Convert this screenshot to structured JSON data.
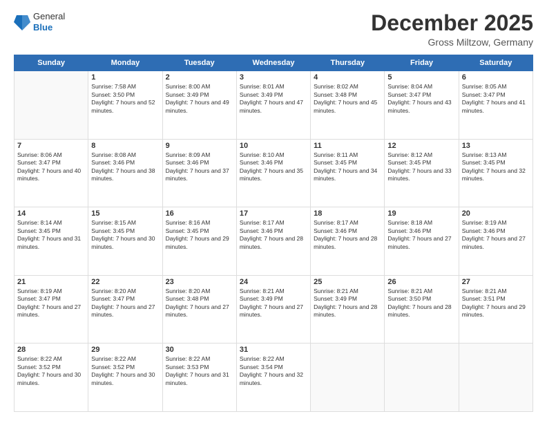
{
  "header": {
    "logo": {
      "general": "General",
      "blue": "Blue"
    },
    "title": "December 2025",
    "location": "Gross Miltzow, Germany"
  },
  "calendar": {
    "weekdays": [
      "Sunday",
      "Monday",
      "Tuesday",
      "Wednesday",
      "Thursday",
      "Friday",
      "Saturday"
    ],
    "weeks": [
      [
        {
          "day": null
        },
        {
          "day": 1,
          "sunrise": "7:58 AM",
          "sunset": "3:50 PM",
          "daylight": "7 hours and 52 minutes."
        },
        {
          "day": 2,
          "sunrise": "8:00 AM",
          "sunset": "3:49 PM",
          "daylight": "7 hours and 49 minutes."
        },
        {
          "day": 3,
          "sunrise": "8:01 AM",
          "sunset": "3:49 PM",
          "daylight": "7 hours and 47 minutes."
        },
        {
          "day": 4,
          "sunrise": "8:02 AM",
          "sunset": "3:48 PM",
          "daylight": "7 hours and 45 minutes."
        },
        {
          "day": 5,
          "sunrise": "8:04 AM",
          "sunset": "3:47 PM",
          "daylight": "7 hours and 43 minutes."
        },
        {
          "day": 6,
          "sunrise": "8:05 AM",
          "sunset": "3:47 PM",
          "daylight": "7 hours and 41 minutes."
        }
      ],
      [
        {
          "day": 7,
          "sunrise": "8:06 AM",
          "sunset": "3:47 PM",
          "daylight": "7 hours and 40 minutes."
        },
        {
          "day": 8,
          "sunrise": "8:08 AM",
          "sunset": "3:46 PM",
          "daylight": "7 hours and 38 minutes."
        },
        {
          "day": 9,
          "sunrise": "8:09 AM",
          "sunset": "3:46 PM",
          "daylight": "7 hours and 37 minutes."
        },
        {
          "day": 10,
          "sunrise": "8:10 AM",
          "sunset": "3:46 PM",
          "daylight": "7 hours and 35 minutes."
        },
        {
          "day": 11,
          "sunrise": "8:11 AM",
          "sunset": "3:45 PM",
          "daylight": "7 hours and 34 minutes."
        },
        {
          "day": 12,
          "sunrise": "8:12 AM",
          "sunset": "3:45 PM",
          "daylight": "7 hours and 33 minutes."
        },
        {
          "day": 13,
          "sunrise": "8:13 AM",
          "sunset": "3:45 PM",
          "daylight": "7 hours and 32 minutes."
        }
      ],
      [
        {
          "day": 14,
          "sunrise": "8:14 AM",
          "sunset": "3:45 PM",
          "daylight": "7 hours and 31 minutes."
        },
        {
          "day": 15,
          "sunrise": "8:15 AM",
          "sunset": "3:45 PM",
          "daylight": "7 hours and 30 minutes."
        },
        {
          "day": 16,
          "sunrise": "8:16 AM",
          "sunset": "3:45 PM",
          "daylight": "7 hours and 29 minutes."
        },
        {
          "day": 17,
          "sunrise": "8:17 AM",
          "sunset": "3:46 PM",
          "daylight": "7 hours and 28 minutes."
        },
        {
          "day": 18,
          "sunrise": "8:17 AM",
          "sunset": "3:46 PM",
          "daylight": "7 hours and 28 minutes."
        },
        {
          "day": 19,
          "sunrise": "8:18 AM",
          "sunset": "3:46 PM",
          "daylight": "7 hours and 27 minutes."
        },
        {
          "day": 20,
          "sunrise": "8:19 AM",
          "sunset": "3:46 PM",
          "daylight": "7 hours and 27 minutes."
        }
      ],
      [
        {
          "day": 21,
          "sunrise": "8:19 AM",
          "sunset": "3:47 PM",
          "daylight": "7 hours and 27 minutes."
        },
        {
          "day": 22,
          "sunrise": "8:20 AM",
          "sunset": "3:47 PM",
          "daylight": "7 hours and 27 minutes."
        },
        {
          "day": 23,
          "sunrise": "8:20 AM",
          "sunset": "3:48 PM",
          "daylight": "7 hours and 27 minutes."
        },
        {
          "day": 24,
          "sunrise": "8:21 AM",
          "sunset": "3:49 PM",
          "daylight": "7 hours and 27 minutes."
        },
        {
          "day": 25,
          "sunrise": "8:21 AM",
          "sunset": "3:49 PM",
          "daylight": "7 hours and 28 minutes."
        },
        {
          "day": 26,
          "sunrise": "8:21 AM",
          "sunset": "3:50 PM",
          "daylight": "7 hours and 28 minutes."
        },
        {
          "day": 27,
          "sunrise": "8:21 AM",
          "sunset": "3:51 PM",
          "daylight": "7 hours and 29 minutes."
        }
      ],
      [
        {
          "day": 28,
          "sunrise": "8:22 AM",
          "sunset": "3:52 PM",
          "daylight": "7 hours and 30 minutes."
        },
        {
          "day": 29,
          "sunrise": "8:22 AM",
          "sunset": "3:52 PM",
          "daylight": "7 hours and 30 minutes."
        },
        {
          "day": 30,
          "sunrise": "8:22 AM",
          "sunset": "3:53 PM",
          "daylight": "7 hours and 31 minutes."
        },
        {
          "day": 31,
          "sunrise": "8:22 AM",
          "sunset": "3:54 PM",
          "daylight": "7 hours and 32 minutes."
        },
        {
          "day": null
        },
        {
          "day": null
        },
        {
          "day": null
        }
      ]
    ]
  }
}
